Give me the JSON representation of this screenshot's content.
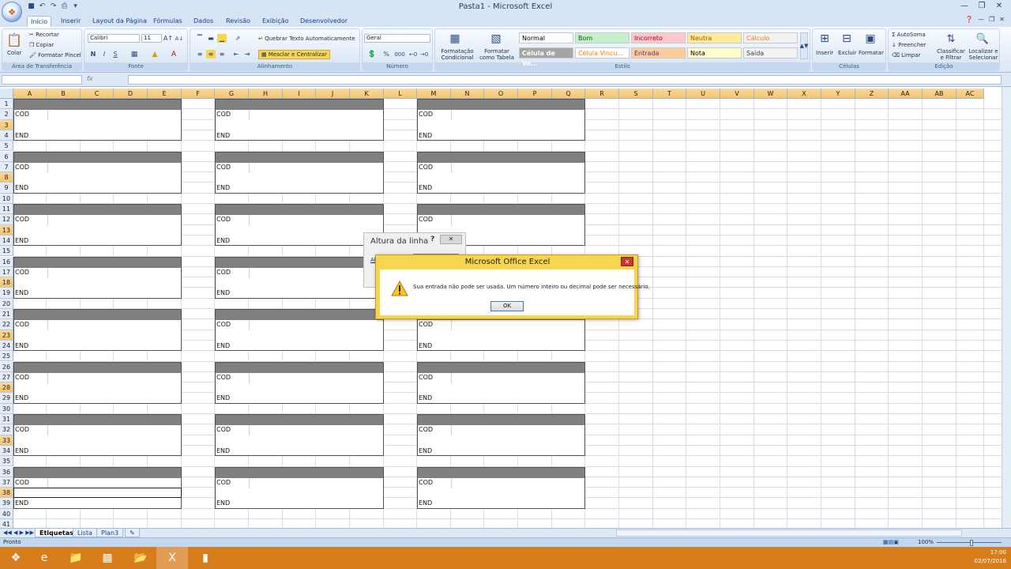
{
  "window": {
    "title": "Pasta1 - Microsoft Excel",
    "logo": "office-logo"
  },
  "qat": {
    "icons": [
      "save-icon",
      "undo-icon",
      "redo-icon",
      "print-icon",
      "customize-icon"
    ]
  },
  "tabs": [
    "Início",
    "Inserir",
    "Layout da Página",
    "Fórmulas",
    "Dados",
    "Revisão",
    "Exibição",
    "Desenvolvedor"
  ],
  "ribbon": {
    "clipboard": {
      "title": "Área de Transferência",
      "paste": "Colar",
      "cut": "Recortar",
      "copy": "Copiar",
      "format_painter": "Formatar Pincel"
    },
    "font": {
      "title": "Fonte",
      "family": "Calibri",
      "size": "11",
      "bold": "N",
      "italic": "I",
      "underline": "S"
    },
    "alignment": {
      "title": "Alinhamento",
      "wrap": "Quebrar Texto Automaticamente",
      "merge": "Mesclar e Centralizar"
    },
    "number": {
      "title": "Número",
      "format": "Geral",
      "percent": "%",
      "thousands": "000"
    },
    "styles": {
      "title": "Estilo",
      "conditional": "Formatação Condicional",
      "as_table": "Formatar como Tabela",
      "items": [
        {
          "label": "Normal",
          "bg": "#ffffff",
          "fg": "#000000"
        },
        {
          "label": "Bom",
          "bg": "#c6efce",
          "fg": "#006100"
        },
        {
          "label": "Incorreto",
          "bg": "#ffc7ce",
          "fg": "#9c0006"
        },
        {
          "label": "Neutra",
          "bg": "#ffeb9c",
          "fg": "#9c5700"
        },
        {
          "label": "Cálculo",
          "bg": "#f2f2f2",
          "fg": "#fa7d00"
        },
        {
          "label": "Célula de Ve...",
          "bg": "#a5a5a5",
          "fg": "#ffffff"
        },
        {
          "label": "Célula Vincu...",
          "bg": "#ffffff",
          "fg": "#fa7d00"
        },
        {
          "label": "Entrada",
          "bg": "#ffcc99",
          "fg": "#3f3f76"
        },
        {
          "label": "Nota",
          "bg": "#ffffcc",
          "fg": "#000000"
        },
        {
          "label": "Saída",
          "bg": "#f2f2f2",
          "fg": "#3f3f3f"
        }
      ]
    },
    "cells": {
      "title": "Células",
      "insert": "Inserir",
      "delete": "Excluir",
      "format": "Formatar"
    },
    "editing": {
      "title": "Edição",
      "autosum": "AutoSoma",
      "fill": "Preencher",
      "clear": "Limpar",
      "sort": "Classificar e Filtrar",
      "find": "Localizar e Selecionar"
    }
  },
  "formula_bar": {
    "fx": "fx"
  },
  "columns": [
    "A",
    "B",
    "C",
    "D",
    "E",
    "F",
    "G",
    "H",
    "I",
    "J",
    "K",
    "L",
    "M",
    "N",
    "O",
    "P",
    "Q",
    "R",
    "S",
    "T",
    "U",
    "V",
    "W",
    "X",
    "Y",
    "Z",
    "AA",
    "AB",
    "AC"
  ],
  "rows": [
    "1",
    "2",
    "3",
    "4",
    "5",
    "6",
    "7",
    "8",
    "9",
    "10",
    "11",
    "12",
    "13",
    "14",
    "15",
    "16",
    "17",
    "18",
    "19",
    "20",
    "21",
    "22",
    "23",
    "24",
    "25",
    "26",
    "27",
    "28",
    "29",
    "30",
    "31",
    "32",
    "33",
    "34",
    "35",
    "36",
    "37",
    "38",
    "39",
    "40",
    "41"
  ],
  "cell_text": {
    "cod": "COD",
    "end": "END"
  },
  "sheets": [
    "Etiquetas",
    "Lista",
    "Plan3"
  ],
  "status": {
    "ready": "Pronto",
    "zoom": "100%"
  },
  "row_height_dialog": {
    "title": "Altura da linha",
    "help": "?",
    "field_label": "Al"
  },
  "alert": {
    "title": "Microsoft Office Excel",
    "message": "Sua entrada não pode ser usada. Um número inteiro ou decimal pode ser necessário.",
    "ok": "OK",
    "icon": "warning-icon"
  },
  "taskbar": {
    "time": "17:00",
    "date": "02/07/2016"
  }
}
